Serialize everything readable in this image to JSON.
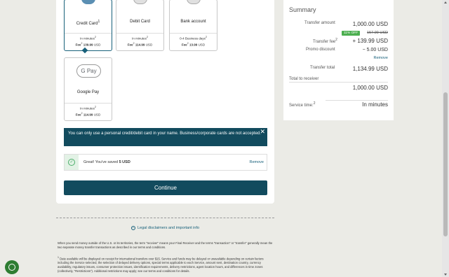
{
  "options": [
    {
      "name": "Credit Card",
      "sup": "1",
      "time": "In minutes",
      "time_sup": "2",
      "fee_label": "Fee",
      "fee_sup": "2",
      "fee": "139.99",
      "unit": "USD",
      "selected": true
    },
    {
      "name": "Debit Card",
      "sup": "",
      "time": "In minutes",
      "time_sup": "2",
      "fee_label": "Fee",
      "fee_sup": "2",
      "fee": "114.99",
      "unit": "USD",
      "selected": false
    },
    {
      "name": "Bank account",
      "sup": "",
      "time": "0-4 Business days",
      "time_sup": "2",
      "fee_label": "Fee",
      "fee_sup": "2",
      "fee": "13.99",
      "unit": "USD",
      "selected": false
    },
    {
      "name": "Google Pay",
      "sup": "",
      "time": "In minutes",
      "time_sup": "2",
      "fee_label": "Fee",
      "fee_sup": "2",
      "fee": "114.99",
      "unit": "USD",
      "selected": false
    }
  ],
  "gpay_logo": "G Pay",
  "notice": {
    "text": "You can only use a personal credit/debit card in your name. Business/corporate cards are not accepted.",
    "close": "✕"
  },
  "saved": {
    "text_pre": "Great! You've saved ",
    "amount": "5 USD",
    "remove": "Remove"
  },
  "continue_label": "Continue",
  "legal_link": "Legal disclaimers and important info",
  "para1": "When you send money outside of the U.S. or its territories, the term \"receiver\" means your Final Receiver and the terms \"transaction\" or \"transfer\" generally mean the two separate money transfer transactions as described in our terms and conditions.",
  "para2": "Date available will be displayed on receipt for international transfers over $15. Service and funds may be delayed or unavailable depending on certain factors including the Service selected, the selection of delayed delivery options, special terms applicable to each Service, amount sent, destination country, currency availability, regulatory issues, consumer protection issues, identification requirements, delivery restrictions, agent location hours, and differences in time zones (collectively, \"Restrictions\"). Additional restrictions may apply; see our terms and conditions for details.",
  "para2_sup": "1",
  "summary": {
    "title": "Summary",
    "transfer_amount_label": "Transfer amount",
    "transfer_amount": "1,000.00 USD",
    "badge": "11% OFF",
    "old_fee": "157.99 USD",
    "fee_label": "Transfer fee",
    "fee_sup": "2",
    "fee": "+ 139.99 USD",
    "promo_label": "Promo discount",
    "promo": "− 5.00 USD",
    "remove": "Remove",
    "total_label": "Transfer total",
    "total": "1,134.99 USD",
    "to_receiver_label": "Total to receiver",
    "to_receiver": "1,000.00 USD",
    "service_label": "Service time:",
    "service_sup": "2",
    "service": "In minutes"
  },
  "colors": {
    "primary": "#124b5e",
    "accent": "#17607a",
    "success": "#4caf50"
  }
}
